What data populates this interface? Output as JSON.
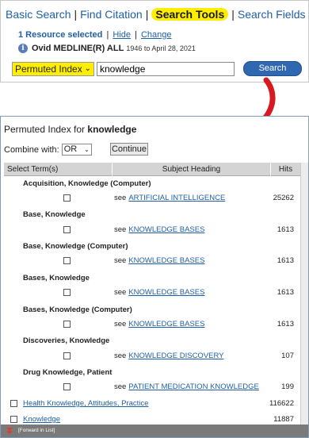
{
  "tabs": [
    {
      "label": "Basic Search",
      "active": false
    },
    {
      "label": "Find Citation",
      "active": false
    },
    {
      "label": "Search Tools",
      "active": true
    },
    {
      "label": "Search Fields",
      "active": false
    }
  ],
  "resources": {
    "selected": "1 Resource selected",
    "hide": "Hide",
    "change": "Change"
  },
  "database": {
    "name": "Ovid MEDLINE(R) ALL",
    "range": "1946 to April 28, 2021",
    "icon": "info-icon"
  },
  "tool_select": {
    "value": "Permuted Index"
  },
  "query": {
    "value": "knowledge"
  },
  "search_button": "Search",
  "accent": {
    "highlight": "#ffee00",
    "arrow": "#d71920",
    "button": "#2f68b1"
  },
  "permuted": {
    "title_prefix": "Permuted Index for ",
    "term": "knowledge",
    "combine_label": "Combine with:",
    "combine_value": "OR",
    "continue": "Continue"
  },
  "table": {
    "headers": {
      "select": "Select Term(s)",
      "subject": "Subject Heading",
      "hits": "Hits"
    },
    "groups": [
      {
        "term": "Acquisition, Knowledge (Computer)",
        "see_prefix": "see",
        "heading": "ARTIFICIAL INTELLIGENCE",
        "hits": "25262"
      },
      {
        "term": "Base, Knowledge",
        "see_prefix": "see",
        "heading": "KNOWLEDGE BASES",
        "hits": "1613"
      },
      {
        "term": "Base, Knowledge (Computer)",
        "see_prefix": "see",
        "heading": "KNOWLEDGE BASES",
        "hits": "1613"
      },
      {
        "term": "Bases, Knowledge",
        "see_prefix": "see",
        "heading": "KNOWLEDGE BASES",
        "hits": "1613"
      },
      {
        "term": "Bases, Knowledge (Computer)",
        "see_prefix": "see",
        "heading": "KNOWLEDGE BASES",
        "hits": "1613"
      },
      {
        "term": "Discoveries, Knowledge",
        "see_prefix": "see",
        "heading": "KNOWLEDGE DISCOVERY",
        "hits": "107"
      },
      {
        "term": "Drug Knowledge, Patient",
        "see_prefix": "see",
        "heading": "PATIENT MEDICATION KNOWLEDGE",
        "hits": "199"
      }
    ],
    "top_terms": [
      {
        "label": "Health Knowledge, Attitudes, Practice",
        "hits": "116622"
      },
      {
        "label": "Knowledge",
        "hits": "11887"
      }
    ]
  },
  "footer": {
    "forward": "[Forward in List]"
  }
}
